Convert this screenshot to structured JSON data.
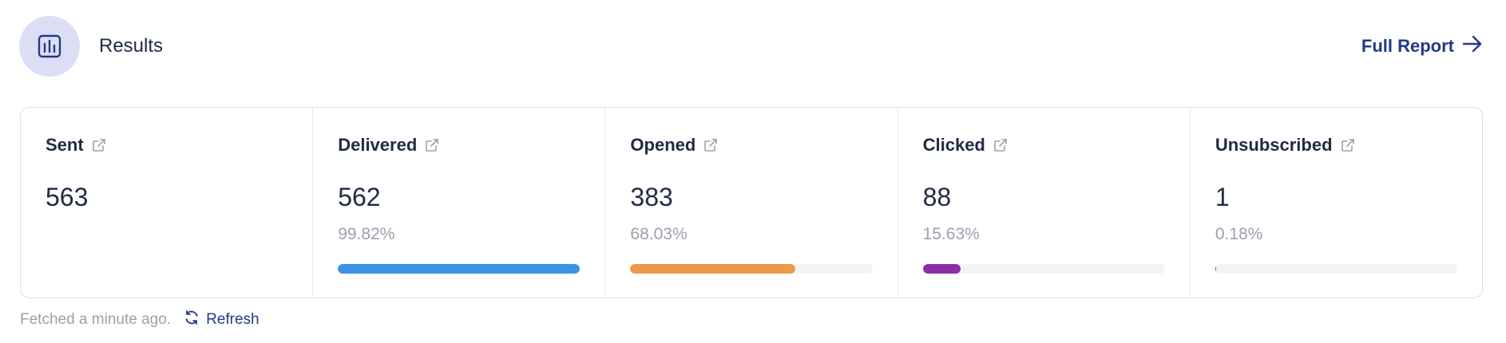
{
  "header": {
    "title": "Results",
    "icon": "bar-chart-icon",
    "full_report_label": "Full Report",
    "accent": "#223a86",
    "icon_bg": "#dcdef5"
  },
  "stats": [
    {
      "label": "Sent",
      "value": "563",
      "percent": "",
      "fraction": null,
      "color": null
    },
    {
      "label": "Delivered",
      "value": "562",
      "percent": "99.82%",
      "fraction": 0.9982,
      "color": "#3a93e6"
    },
    {
      "label": "Opened",
      "value": "383",
      "percent": "68.03%",
      "fraction": 0.6803,
      "color": "#eb9a4a"
    },
    {
      "label": "Clicked",
      "value": "88",
      "percent": "15.63%",
      "fraction": 0.1563,
      "color": "#8a2fa8"
    },
    {
      "label": "Unsubscribed",
      "value": "1",
      "percent": "0.18%",
      "fraction": 0.0018,
      "color": "#d83a63"
    }
  ],
  "footer": {
    "fetched_text": "Fetched a minute ago.",
    "refresh_label": "Refresh"
  }
}
